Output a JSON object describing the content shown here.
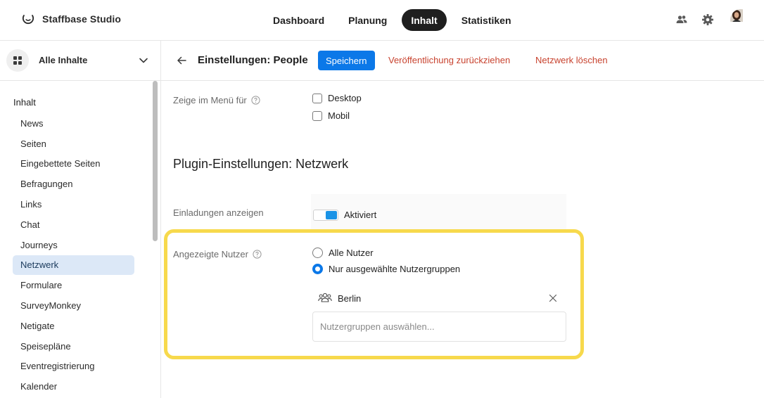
{
  "app": {
    "name": "Staffbase Studio"
  },
  "top_nav": [
    {
      "label": "Dashboard",
      "active": false
    },
    {
      "label": "Planung",
      "active": false
    },
    {
      "label": "Inhalt",
      "active": true
    },
    {
      "label": "Statistiken",
      "active": false
    }
  ],
  "top_icons": [
    "users-icon",
    "gear-icon",
    "user-avatar"
  ],
  "sidebar": {
    "selector_label": "Alle Inhalte",
    "root_label": "Inhalt",
    "items": [
      {
        "label": "News"
      },
      {
        "label": "Seiten"
      },
      {
        "label": "Eingebettete Seiten"
      },
      {
        "label": "Befragungen"
      },
      {
        "label": "Links"
      },
      {
        "label": "Chat"
      },
      {
        "label": "Journeys"
      },
      {
        "label": "Netzwerk",
        "active": true
      },
      {
        "label": "Formulare"
      },
      {
        "label": "SurveyMonkey"
      },
      {
        "label": "Netigate"
      },
      {
        "label": "Speisepläne"
      },
      {
        "label": "Eventregistrierung"
      },
      {
        "label": "Kalender"
      }
    ]
  },
  "header": {
    "title": "Einstellungen: People",
    "save_label": "Speichern",
    "unpublish_label": "Veröffentlichung zurückziehen",
    "delete_label": "Netzwerk löschen"
  },
  "menu_visibility": {
    "label": "Zeige im Menü für",
    "options": [
      {
        "label": "Desktop",
        "checked": false
      },
      {
        "label": "Mobil",
        "checked": false
      }
    ]
  },
  "plugin": {
    "section_title": "Plugin-Einstellungen: Netzwerk",
    "invitations": {
      "label": "Einladungen anzeigen",
      "toggle_label": "Aktiviert",
      "enabled": true
    },
    "users": {
      "label": "Angezeigte Nutzer",
      "options": [
        {
          "label": "Alle Nutzer",
          "selected": false
        },
        {
          "label": "Nur ausgewählte Nutzergruppen",
          "selected": true
        }
      ],
      "selected_group": "Berlin",
      "input_placeholder": "Nutzergruppen auswählen..."
    }
  },
  "colors": {
    "primary": "#0b78e8",
    "danger": "#c8432f",
    "highlight": "#f7d94c",
    "active_bg": "#dce8f7"
  }
}
